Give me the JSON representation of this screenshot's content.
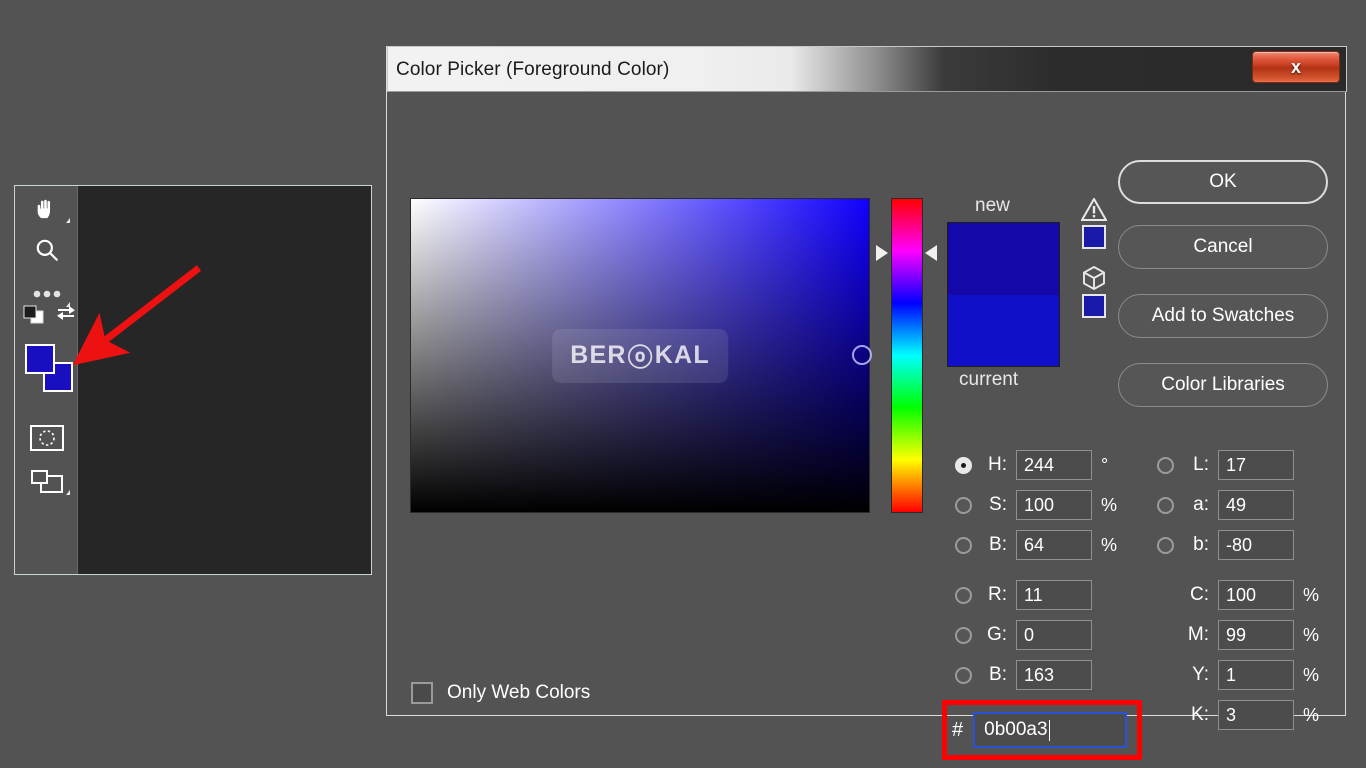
{
  "app": {
    "workspace_bg": "#535353",
    "canvas_bg": "#262626"
  },
  "toolbar": {
    "tools": [
      {
        "name": "hand-tool",
        "label": "Hand Tool"
      },
      {
        "name": "zoom-tool",
        "label": "Zoom Tool"
      },
      {
        "name": "edit-toolbar-tool",
        "label": "Edit Toolbar"
      }
    ],
    "default_colors_label": "Default Foreground and Background Colors",
    "swap_colors_label": "Switch Foreground and Background Colors",
    "foreground_color": "#1a0fc0",
    "background_color": "#1a0fc0",
    "quick_mask_label": "Edit in Quick Mask Mode",
    "screen_mode_label": "Change Screen Mode"
  },
  "annotation": {
    "arrow_color": "#ee1111",
    "highlight_color": "#ff0000"
  },
  "dialog": {
    "title": "Color Picker (Foreground Color)",
    "close_label": "x",
    "buttons": [
      {
        "name": "ok-button",
        "label": "OK",
        "primary": true
      },
      {
        "name": "cancel-button",
        "label": "Cancel",
        "primary": false
      },
      {
        "name": "add-to-swatches-button",
        "label": "Add to Swatches",
        "primary": false
      },
      {
        "name": "color-libraries-button",
        "label": "Color Libraries",
        "primary": false
      }
    ],
    "watermark": {
      "prefix": "BER",
      "glyph": "ⓞ",
      "suffix": "KAL"
    },
    "only_web_colors": {
      "label": "Only Web Colors",
      "checked": false
    },
    "preview": {
      "new_label": "new",
      "current_label": "current",
      "new_color": "#1408a8",
      "current_color": "#1010c8"
    },
    "warnings": {
      "gamut_icon": "warning-triangle-icon",
      "gamut_swatch": "#1a1aa8",
      "websafe_icon": "cube-icon",
      "websafe_swatch": "#1a1aa8"
    },
    "hsb": [
      {
        "name": "h",
        "label": "H:",
        "value": "244",
        "unit": "°",
        "selected": true
      },
      {
        "name": "s",
        "label": "S:",
        "value": "100",
        "unit": "%",
        "selected": false
      },
      {
        "name": "b",
        "label": "B:",
        "value": "64",
        "unit": "%",
        "selected": false
      }
    ],
    "rgb": [
      {
        "name": "r",
        "label": "R:",
        "value": "11",
        "unit": "",
        "selected": false
      },
      {
        "name": "g",
        "label": "G:",
        "value": "0",
        "unit": "",
        "selected": false
      },
      {
        "name": "b",
        "label": "B:",
        "value": "163",
        "unit": "",
        "selected": false
      }
    ],
    "lab": [
      {
        "name": "l",
        "label": "L:",
        "value": "17",
        "unit": "",
        "selected": false
      },
      {
        "name": "a",
        "label": "a:",
        "value": "49",
        "unit": "",
        "selected": false
      },
      {
        "name": "b",
        "label": "b:",
        "value": "-80",
        "unit": "",
        "selected": false
      }
    ],
    "cmyk": [
      {
        "name": "c",
        "label": "C:",
        "value": "100",
        "unit": "%"
      },
      {
        "name": "m",
        "label": "M:",
        "value": "99",
        "unit": "%"
      },
      {
        "name": "y",
        "label": "Y:",
        "value": "1",
        "unit": "%"
      },
      {
        "name": "k",
        "label": "K:",
        "value": "3",
        "unit": "%"
      }
    ],
    "hex": {
      "symbol": "#",
      "value": "0b00a3"
    }
  }
}
